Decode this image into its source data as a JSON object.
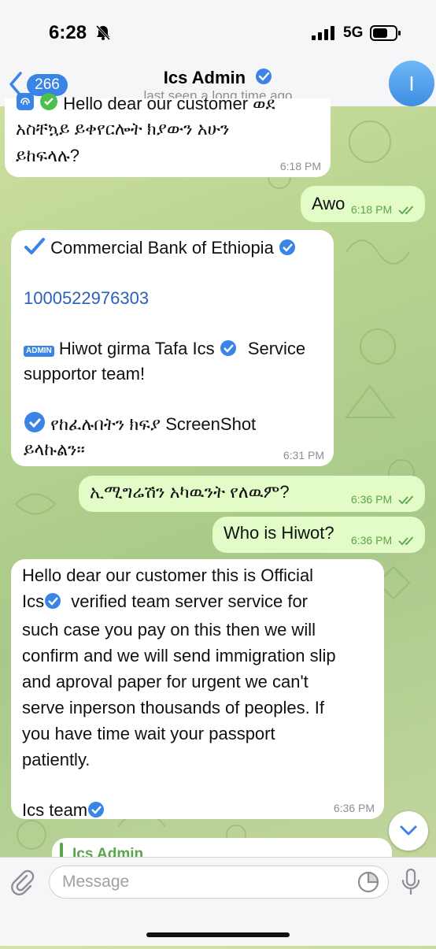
{
  "status_bar": {
    "time": "6:28",
    "network": "5G"
  },
  "header": {
    "back_count": "266",
    "title": "Ics Admin",
    "subtitle": "last seen a long time ago",
    "avatar_letter": "I"
  },
  "messages": [
    {
      "direction": "incoming",
      "lines": [
        "Hello dear our customer ወደ",
        "አስቸኳይ ይቀየርሎት ክያውን አሁን",
        "ይከፍላሉ?"
      ],
      "time": "6:18 PM"
    },
    {
      "direction": "outgoing",
      "text": "Awo",
      "time": "6:18 PM",
      "read": true
    },
    {
      "direction": "incoming",
      "bank": "Commercial Bank of Ethiopia",
      "account": "1000522976303",
      "admin_badge": "ADMIN",
      "agent_line1": "Hiwot girma Tafa Ics",
      "agent_line1_suffix": "Service",
      "agent_line2": "supportor team!",
      "request_line1": "የከፈሉበትን ክፍያ ScreenShot",
      "request_line2": "ይላኩልን።",
      "time": "6:31 PM"
    },
    {
      "direction": "outgoing",
      "text": "ኢሚግሬሽን አካዉንት የለዉም?",
      "time": "6:36 PM",
      "read": true
    },
    {
      "direction": "outgoing",
      "text": "Who is Hiwot?",
      "time": "6:36 PM",
      "read": true
    },
    {
      "direction": "incoming",
      "line1": "Hello dear our customer this is Official",
      "line2_a": "Ics",
      "line2_b": "verified team server service for",
      "line3": "such case you pay on this then we will",
      "line4": "confirm and we will send immigration slip",
      "line5": "and aproval paper for urgent we can't",
      "line6": "serve inperson thousands of peoples. If",
      "line7": "you have time wait your passport",
      "line8": "patiently.",
      "signature": "Ics team",
      "time": "6:36 PM"
    },
    {
      "direction": "incoming",
      "reply_to": "Ics Admin"
    }
  ],
  "composer": {
    "placeholder": "Message"
  },
  "colors": {
    "accent": "#3a84e6",
    "outgoing_bubble": "#e2fbc7",
    "incoming_bubble": "#ffffff",
    "read_ticks": "#5aa64a",
    "link": "#2a62b8"
  },
  "icons": [
    "bell-slash-icon",
    "signal-icon",
    "battery-icon",
    "back-chevron-icon",
    "verified-icon",
    "fingerprint-icon",
    "check-mark-icon",
    "admin-badge-icon",
    "double-check-icon",
    "chevron-down-icon",
    "paperclip-icon",
    "sticker-icon",
    "microphone-icon"
  ]
}
